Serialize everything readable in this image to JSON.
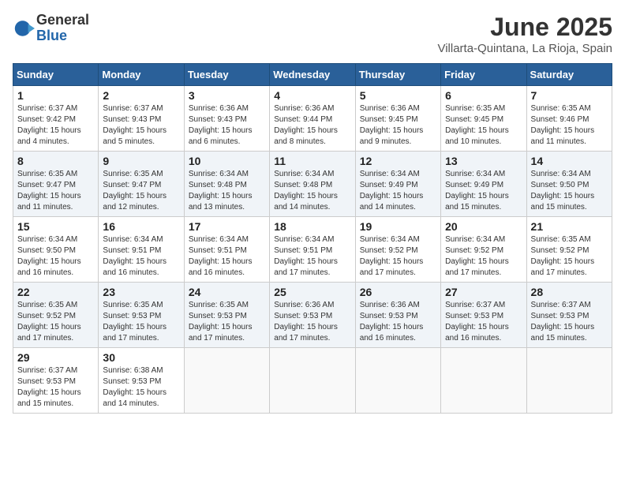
{
  "logo": {
    "general": "General",
    "blue": "Blue"
  },
  "header": {
    "month_year": "June 2025",
    "location": "Villarta-Quintana, La Rioja, Spain"
  },
  "weekdays": [
    "Sunday",
    "Monday",
    "Tuesday",
    "Wednesday",
    "Thursday",
    "Friday",
    "Saturday"
  ],
  "weeks": [
    [
      {
        "day": "1",
        "sunrise": "6:37 AM",
        "sunset": "9:42 PM",
        "daylight": "15 hours and 4 minutes."
      },
      {
        "day": "2",
        "sunrise": "6:37 AM",
        "sunset": "9:43 PM",
        "daylight": "15 hours and 5 minutes."
      },
      {
        "day": "3",
        "sunrise": "6:36 AM",
        "sunset": "9:43 PM",
        "daylight": "15 hours and 6 minutes."
      },
      {
        "day": "4",
        "sunrise": "6:36 AM",
        "sunset": "9:44 PM",
        "daylight": "15 hours and 8 minutes."
      },
      {
        "day": "5",
        "sunrise": "6:36 AM",
        "sunset": "9:45 PM",
        "daylight": "15 hours and 9 minutes."
      },
      {
        "day": "6",
        "sunrise": "6:35 AM",
        "sunset": "9:45 PM",
        "daylight": "15 hours and 10 minutes."
      },
      {
        "day": "7",
        "sunrise": "6:35 AM",
        "sunset": "9:46 PM",
        "daylight": "15 hours and 11 minutes."
      }
    ],
    [
      {
        "day": "8",
        "sunrise": "6:35 AM",
        "sunset": "9:47 PM",
        "daylight": "15 hours and 11 minutes."
      },
      {
        "day": "9",
        "sunrise": "6:35 AM",
        "sunset": "9:47 PM",
        "daylight": "15 hours and 12 minutes."
      },
      {
        "day": "10",
        "sunrise": "6:34 AM",
        "sunset": "9:48 PM",
        "daylight": "15 hours and 13 minutes."
      },
      {
        "day": "11",
        "sunrise": "6:34 AM",
        "sunset": "9:48 PM",
        "daylight": "15 hours and 14 minutes."
      },
      {
        "day": "12",
        "sunrise": "6:34 AM",
        "sunset": "9:49 PM",
        "daylight": "15 hours and 14 minutes."
      },
      {
        "day": "13",
        "sunrise": "6:34 AM",
        "sunset": "9:49 PM",
        "daylight": "15 hours and 15 minutes."
      },
      {
        "day": "14",
        "sunrise": "6:34 AM",
        "sunset": "9:50 PM",
        "daylight": "15 hours and 15 minutes."
      }
    ],
    [
      {
        "day": "15",
        "sunrise": "6:34 AM",
        "sunset": "9:50 PM",
        "daylight": "15 hours and 16 minutes."
      },
      {
        "day": "16",
        "sunrise": "6:34 AM",
        "sunset": "9:51 PM",
        "daylight": "15 hours and 16 minutes."
      },
      {
        "day": "17",
        "sunrise": "6:34 AM",
        "sunset": "9:51 PM",
        "daylight": "15 hours and 16 minutes."
      },
      {
        "day": "18",
        "sunrise": "6:34 AM",
        "sunset": "9:51 PM",
        "daylight": "15 hours and 17 minutes."
      },
      {
        "day": "19",
        "sunrise": "6:34 AM",
        "sunset": "9:52 PM",
        "daylight": "15 hours and 17 minutes."
      },
      {
        "day": "20",
        "sunrise": "6:34 AM",
        "sunset": "9:52 PM",
        "daylight": "15 hours and 17 minutes."
      },
      {
        "day": "21",
        "sunrise": "6:35 AM",
        "sunset": "9:52 PM",
        "daylight": "15 hours and 17 minutes."
      }
    ],
    [
      {
        "day": "22",
        "sunrise": "6:35 AM",
        "sunset": "9:52 PM",
        "daylight": "15 hours and 17 minutes."
      },
      {
        "day": "23",
        "sunrise": "6:35 AM",
        "sunset": "9:53 PM",
        "daylight": "15 hours and 17 minutes."
      },
      {
        "day": "24",
        "sunrise": "6:35 AM",
        "sunset": "9:53 PM",
        "daylight": "15 hours and 17 minutes."
      },
      {
        "day": "25",
        "sunrise": "6:36 AM",
        "sunset": "9:53 PM",
        "daylight": "15 hours and 17 minutes."
      },
      {
        "day": "26",
        "sunrise": "6:36 AM",
        "sunset": "9:53 PM",
        "daylight": "15 hours and 16 minutes."
      },
      {
        "day": "27",
        "sunrise": "6:37 AM",
        "sunset": "9:53 PM",
        "daylight": "15 hours and 16 minutes."
      },
      {
        "day": "28",
        "sunrise": "6:37 AM",
        "sunset": "9:53 PM",
        "daylight": "15 hours and 15 minutes."
      }
    ],
    [
      {
        "day": "29",
        "sunrise": "6:37 AM",
        "sunset": "9:53 PM",
        "daylight": "15 hours and 15 minutes."
      },
      {
        "day": "30",
        "sunrise": "6:38 AM",
        "sunset": "9:53 PM",
        "daylight": "15 hours and 14 minutes."
      },
      null,
      null,
      null,
      null,
      null
    ]
  ]
}
